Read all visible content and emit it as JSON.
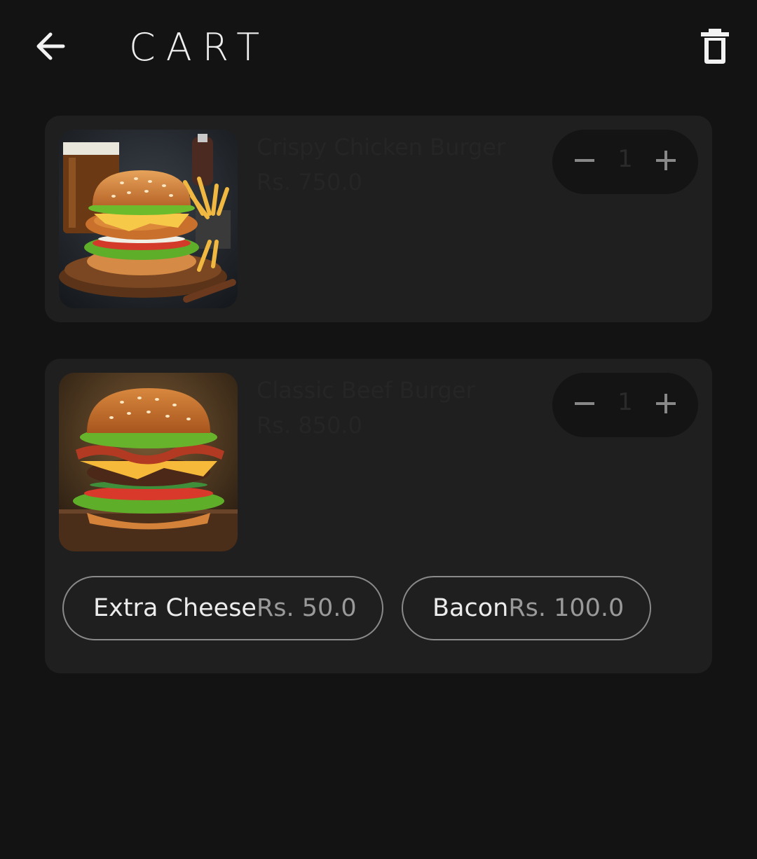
{
  "header": {
    "title": "CART",
    "back_icon": "arrow-left-icon",
    "clear_icon": "trash-icon"
  },
  "cart_items": [
    {
      "name": "Crispy Chicken Burger",
      "price": "Rs. 750.0",
      "quantity": "1",
      "image_icon": "crispy-chicken-burger-image"
    },
    {
      "name": "Classic Beef Burger",
      "price": "Rs. 850.0",
      "quantity": "1",
      "image_icon": "classic-beef-burger-image",
      "addons": [
        {
          "name": "Extra Cheese",
          "price": "Rs. 50.0"
        },
        {
          "name": "Bacon",
          "price": "Rs. 100.0"
        }
      ]
    }
  ],
  "colors": {
    "background": "#131313",
    "card": "#1f1f1f",
    "stepper": "#141414",
    "chip_border": "#8a8a8a"
  }
}
